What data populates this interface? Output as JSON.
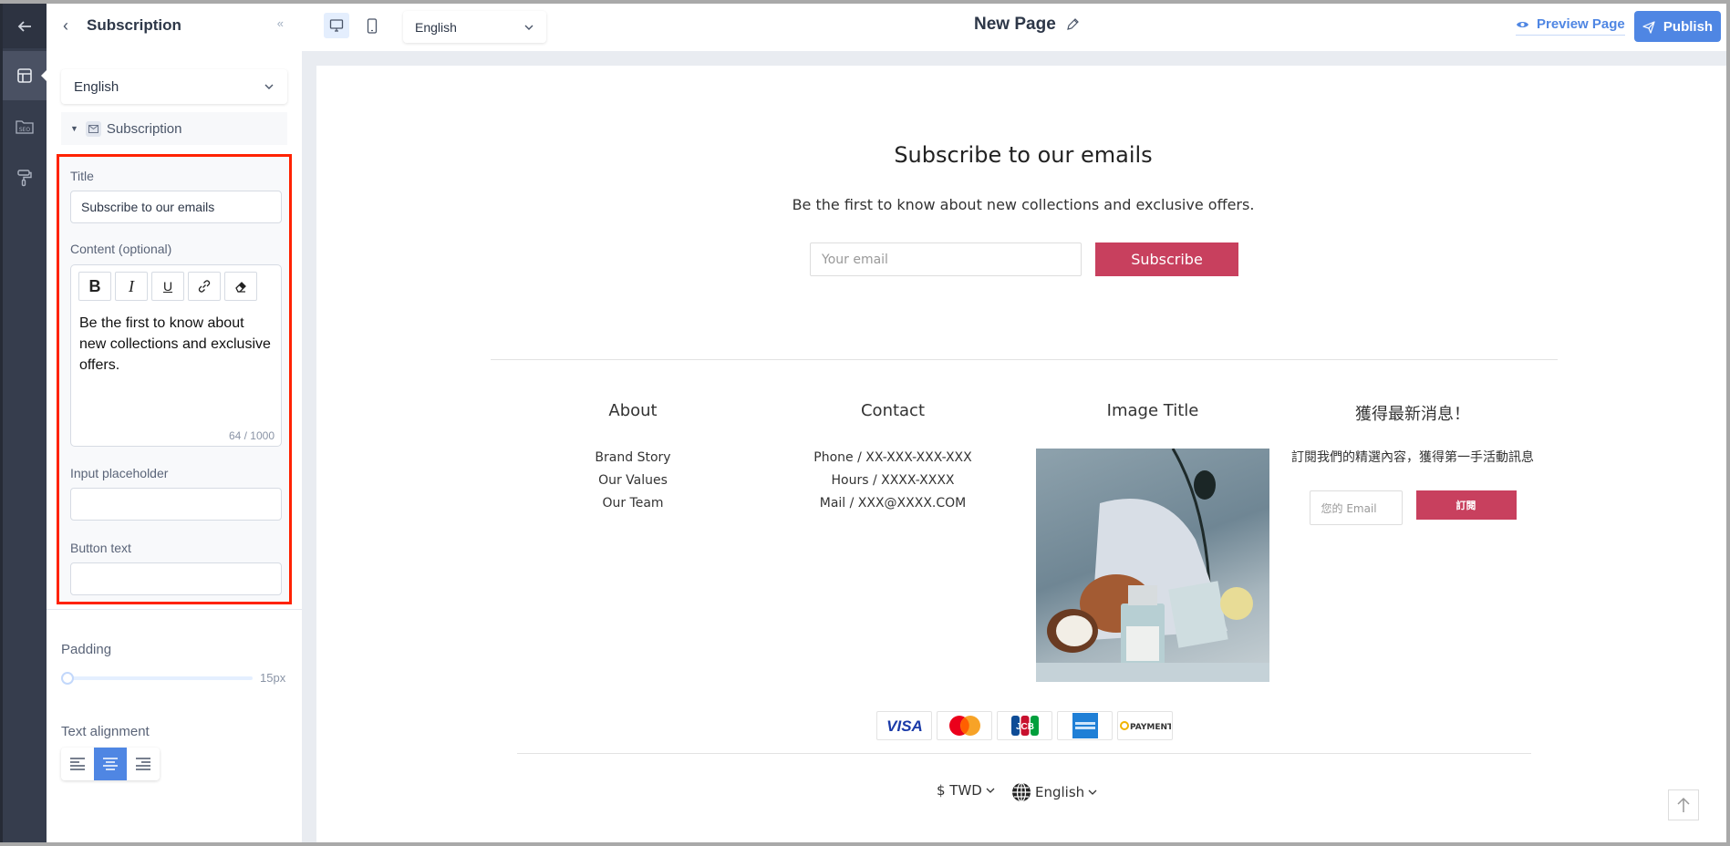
{
  "rail": {
    "items": [
      {
        "name": "back",
        "icon": "arrow-left-icon"
      },
      {
        "name": "layout",
        "icon": "layout-icon",
        "active": true
      },
      {
        "name": "seo",
        "icon": "seo-folder-icon",
        "text": "SEO"
      },
      {
        "name": "theme",
        "icon": "paint-roller-icon"
      }
    ]
  },
  "panel": {
    "title": "Subscription",
    "language": "English",
    "tree_node": "Subscription",
    "fields": {
      "title_label": "Title",
      "title_value": "Subscribe to our emails",
      "content_label": "Content (optional)",
      "content_value": "Be the first to know about new collections and exclusive offers.",
      "content_counter": "64 / 1000",
      "toolbar": [
        "bold",
        "italic",
        "underline",
        "link",
        "clear-format"
      ],
      "placeholder_label": "Input placeholder",
      "placeholder_value": "",
      "button_label": "Button text",
      "button_value": ""
    },
    "padding_label": "Padding",
    "padding_value": "15px",
    "padding_fraction": 0.0,
    "alignment_label": "Text alignment",
    "alignment_options": [
      "left",
      "center",
      "right"
    ],
    "alignment_selected": "center",
    "highlight_color": "#ff2200"
  },
  "topbar": {
    "devices": [
      "desktop",
      "mobile"
    ],
    "device_selected": "desktop",
    "language": "English",
    "page_title": "New Page",
    "preview_label": "Preview Page",
    "publish_label": "Publish",
    "accent": "#4f86e3"
  },
  "canvas": {
    "subscribe": {
      "title": "Subscribe to our emails",
      "description": "Be the first to know about new collections and exclusive offers.",
      "email_placeholder": "Your email",
      "button": "Subscribe",
      "button_color": "#c8405e"
    },
    "footer": {
      "about": {
        "heading": "About",
        "links": [
          "Brand Story",
          "Our Values",
          "Our Team"
        ]
      },
      "contact": {
        "heading": "Contact",
        "lines": [
          "Phone / XX-XXX-XXX-XXX",
          "Hours / XXXX-XXXX",
          "Mail / XXX@XXXX.COM"
        ]
      },
      "image": {
        "heading": "Image Title"
      },
      "newsletter": {
        "heading": "獲得最新消息！",
        "text": "訂閱我們的精選內容，獲得第一手活動訊息",
        "email_placeholder": "您的 Email",
        "button": "訂閱"
      },
      "payments": [
        "VISA",
        "Mastercard",
        "JCB",
        "American Express",
        "PAYMENTS"
      ],
      "currency": "$ TWD",
      "language": "English"
    }
  }
}
